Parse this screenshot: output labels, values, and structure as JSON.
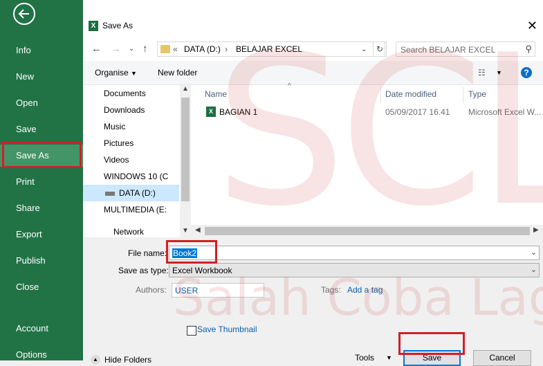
{
  "sidebar": {
    "back_icon": "back-arrow-icon",
    "items": [
      {
        "label": "Info"
      },
      {
        "label": "New"
      },
      {
        "label": "Open"
      },
      {
        "label": "Save"
      },
      {
        "label": "Save As",
        "active": true
      },
      {
        "label": "Print"
      },
      {
        "label": "Share"
      },
      {
        "label": "Export"
      },
      {
        "label": "Publish"
      },
      {
        "label": "Close"
      },
      {
        "label": "Account"
      },
      {
        "label": "Options"
      }
    ],
    "bg_color": "#217346",
    "active_color": "#439467"
  },
  "dialog": {
    "title": "Save As",
    "close_label": "✕",
    "address": {
      "prefix": "«",
      "crumbs": [
        "DATA (D:)",
        "BELAJAR EXCEL"
      ],
      "separator": "›"
    },
    "search_placeholder": "Search BELAJAR EXCEL",
    "toolbar": {
      "organise": "Organise",
      "new_folder": "New folder"
    },
    "nav_pane": [
      {
        "label": "Documents",
        "icon": "documents-icon"
      },
      {
        "label": "Downloads",
        "icon": "downloads-icon"
      },
      {
        "label": "Music",
        "icon": "music-icon"
      },
      {
        "label": "Pictures",
        "icon": "pictures-icon"
      },
      {
        "label": "Videos",
        "icon": "videos-icon"
      },
      {
        "label": "WINDOWS 10 (C",
        "icon": "drive-icon"
      },
      {
        "label": "DATA (D:)",
        "icon": "drive-icon",
        "selected": true
      },
      {
        "label": "MULTIMEDIA (E:",
        "icon": "drive-icon"
      },
      {
        "label": "Network",
        "icon": "network-icon"
      }
    ],
    "columns": [
      "Name",
      "Date modified",
      "Type"
    ],
    "files": [
      {
        "name": "BAGIAN 1",
        "date_modified": "05/09/2017 16.41",
        "type": "Microsoft Excel W..."
      }
    ],
    "form": {
      "file_name_label": "File name:",
      "file_name_value": "Book2",
      "save_type_label": "Save as type:",
      "save_type_value": "Excel Workbook",
      "authors_label": "Authors:",
      "authors_value": "USER",
      "tags_label": "Tags:",
      "tags_value": "Add a tag",
      "thumbnail_label": "Save Thumbnail",
      "hide_folders": "Hide Folders",
      "tools": "Tools",
      "save": "Save",
      "cancel": "Cancel"
    }
  },
  "watermark": {
    "text1": "SCL",
    "text2": "Salah Coba Lagi"
  },
  "colors": {
    "highlight": "#d11f26",
    "selection": "#0078d7",
    "link": "#0c5ea8"
  }
}
